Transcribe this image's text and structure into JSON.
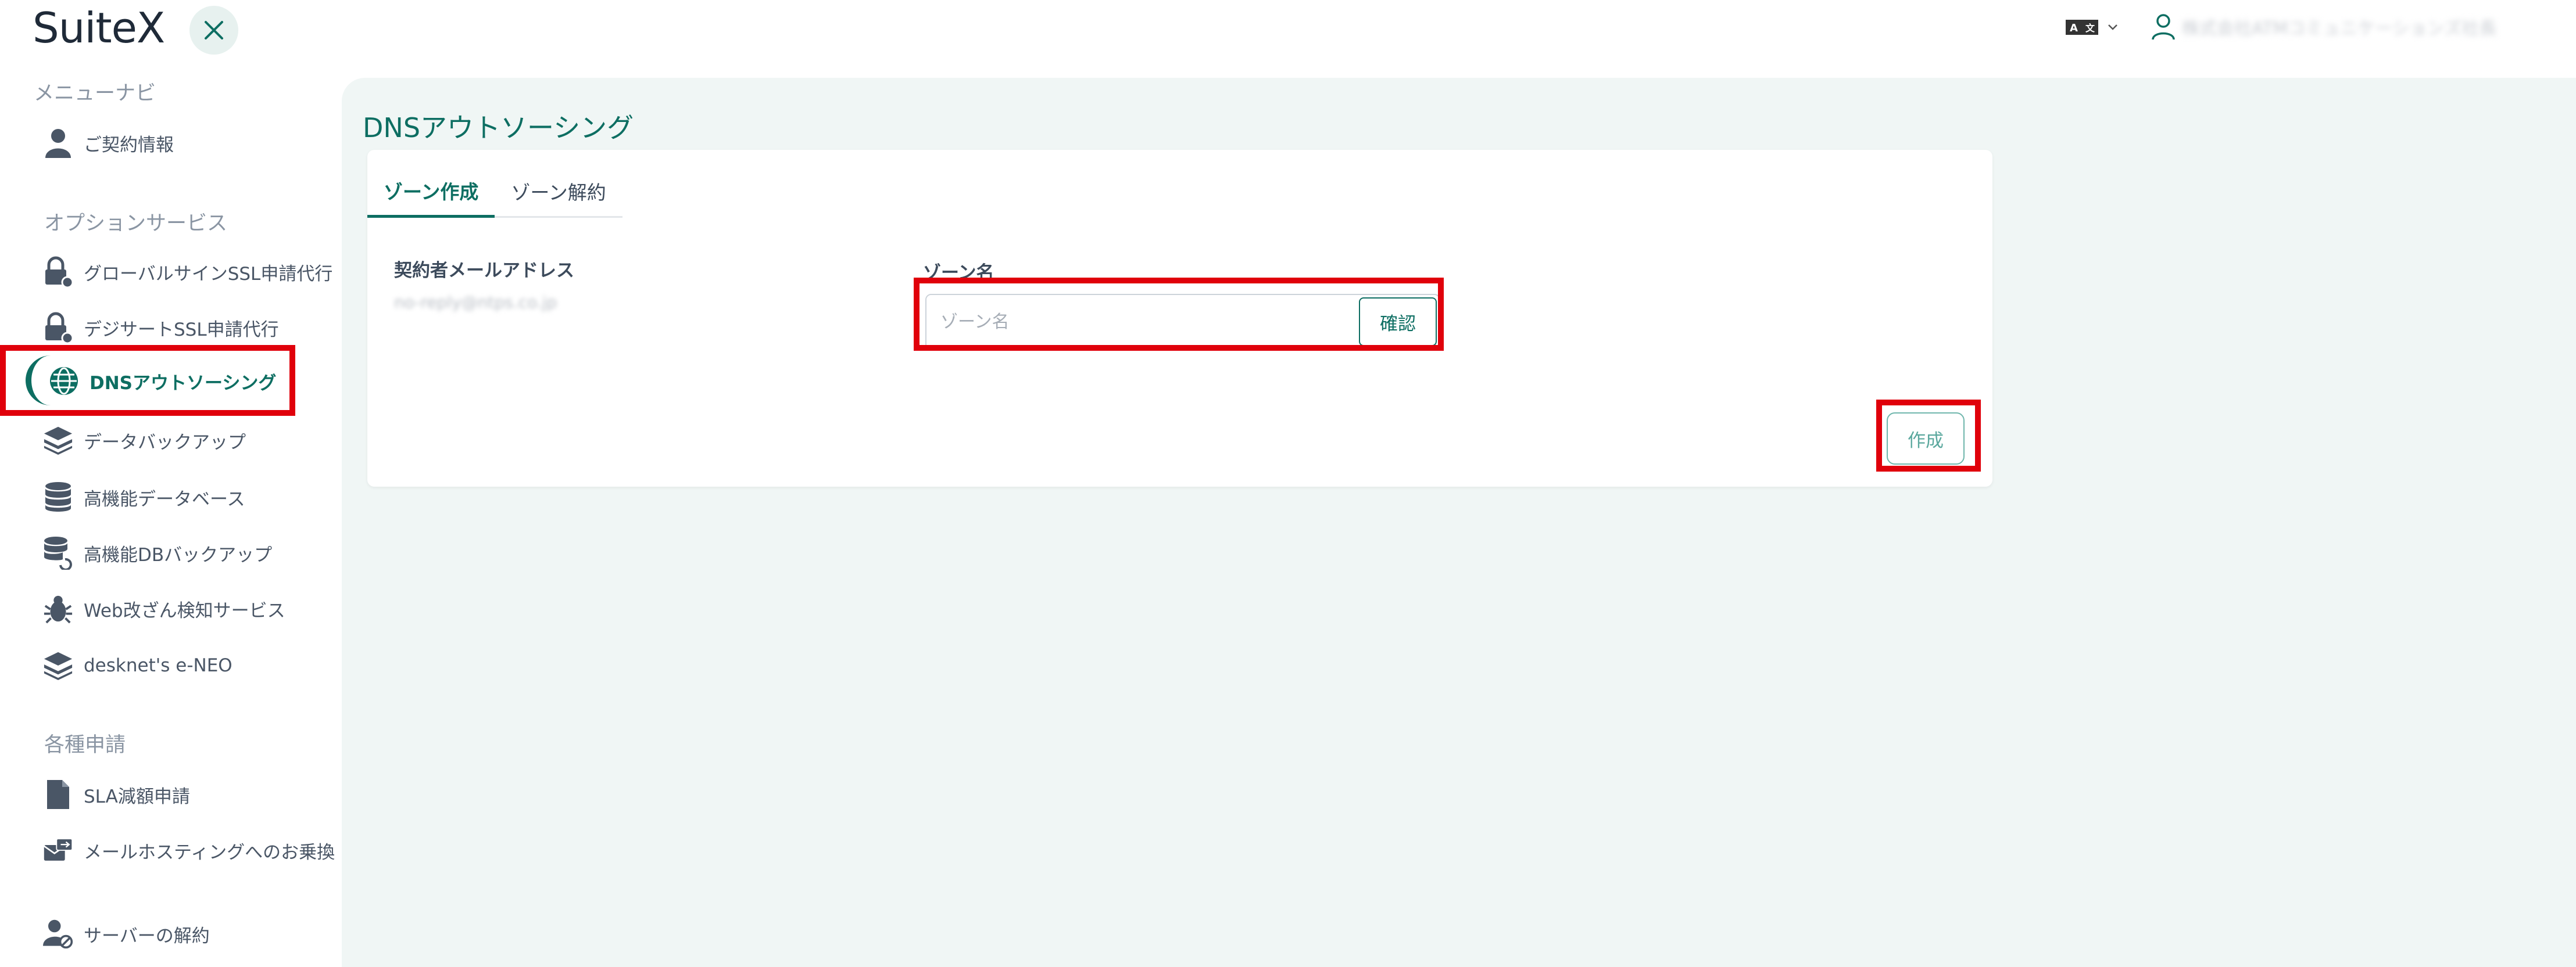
{
  "header": {
    "logo": "SuiteX",
    "user_name": "株式会社ATMコミュニケーションズ社長"
  },
  "sidebar": {
    "sections": [
      {
        "title": "メニューナビ"
      },
      {
        "title": "オプションサービス"
      },
      {
        "title": "各種申請"
      }
    ],
    "items": [
      {
        "label": "ご契約情報",
        "icon": "user-icon"
      },
      {
        "label": "グローバルサインSSL申請代行",
        "icon": "lock-gear-icon"
      },
      {
        "label": "デジサートSSL申請代行",
        "icon": "lock-gear-icon"
      },
      {
        "label": "DNSアウトソーシング",
        "icon": "globe-icon",
        "active": true
      },
      {
        "label": "データバックアップ",
        "icon": "layers-icon"
      },
      {
        "label": "高機能データベース",
        "icon": "database-icon"
      },
      {
        "label": "高機能DBバックアップ",
        "icon": "database-restore-icon"
      },
      {
        "label": "Web改ざん検知サービス",
        "icon": "bug-icon"
      },
      {
        "label": "desknet's e-NEO",
        "icon": "layers-icon"
      },
      {
        "label": "SLA減額申請",
        "icon": "document-icon"
      },
      {
        "label": "メールホスティングへのお乗換",
        "icon": "mail-switch-icon"
      },
      {
        "label": "サーバーの解約",
        "icon": "user-cancel-icon"
      }
    ]
  },
  "main": {
    "title": "DNSアウトソーシング",
    "tabs": [
      {
        "label": "ゾーン作成",
        "active": true
      },
      {
        "label": "ゾーン解約",
        "active": false
      }
    ],
    "email_label": "契約者メールアドレス",
    "email_value": "no-reply@ntps.co.jp",
    "zone_label": "ゾーン名",
    "zone_placeholder": "ゾーン名",
    "zone_value": "",
    "confirm_label": "確認",
    "create_label": "作成"
  },
  "colors": {
    "accent": "#0d6e62",
    "highlight": "#e0000b",
    "main_bg": "#f0f6f5"
  }
}
